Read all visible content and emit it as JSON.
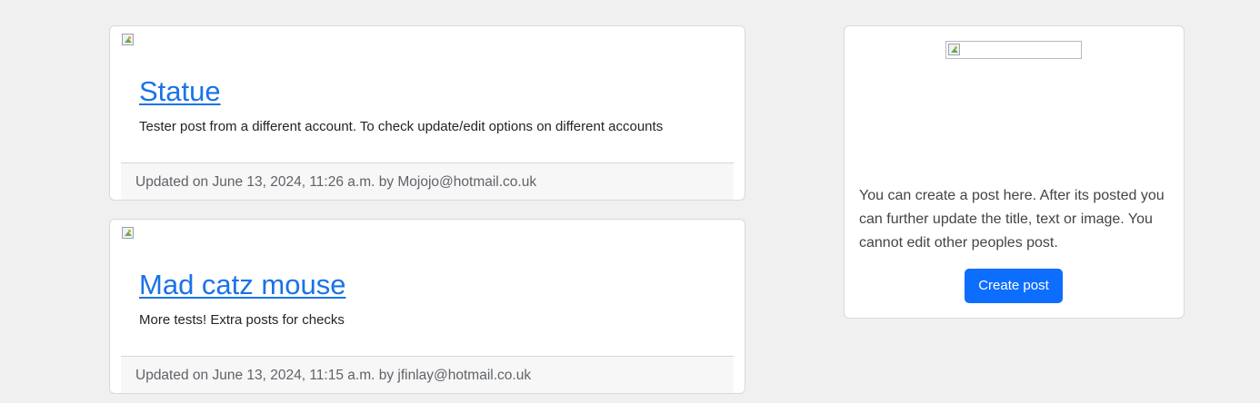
{
  "posts": [
    {
      "title": "Statue",
      "text": "Tester post from a different account. To check update/edit options on different accounts",
      "footer": "Updated on June 13, 2024, 11:26 a.m. by Mojojo@hotmail.co.uk",
      "image_icon": "broken-image-icon"
    },
    {
      "title": "Mad catz mouse",
      "text": "More tests! Extra posts for checks",
      "footer": "Updated on June 13, 2024, 11:15 a.m. by jfinlay@hotmail.co.uk",
      "image_icon": "broken-image-icon"
    }
  ],
  "sidebar": {
    "image_icon": "broken-image-icon",
    "description": "You can create a post here. After its posted you can further update the title, text or image. You cannot edit other peoples post.",
    "create_button_label": "Create post"
  },
  "colors": {
    "background": "#f0f0f0",
    "link": "#1a73e8",
    "primary_button": "#0d6efd"
  }
}
